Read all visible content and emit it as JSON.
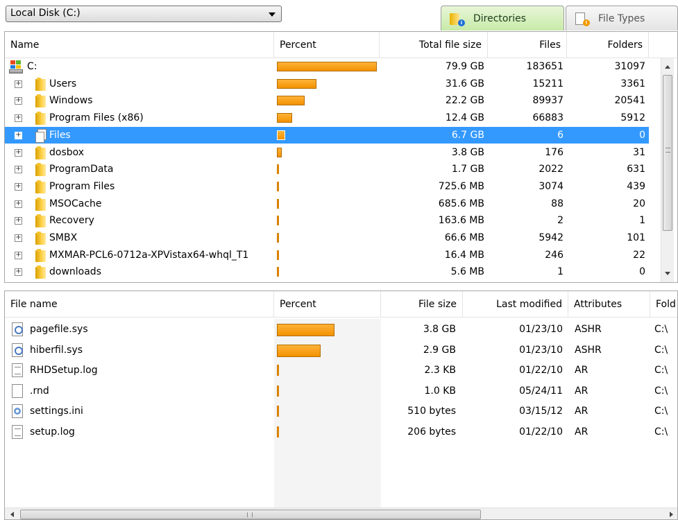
{
  "drive_select": {
    "value": "Local Disk (C:)"
  },
  "tabs": [
    {
      "label": "Directories",
      "active": true,
      "icon": "folder-info-icon"
    },
    {
      "label": "File Types",
      "active": false,
      "icon": "file-warning-icon"
    }
  ],
  "directories": {
    "columns": [
      "Name",
      "Percent",
      "Total file size",
      "Files",
      "Folders"
    ],
    "rows": [
      {
        "name": "C:",
        "percent": 100,
        "size": "79.9 GB",
        "files": "183651",
        "folders": "31097",
        "icon": "drive-icon",
        "selected": false
      },
      {
        "name": "Users",
        "percent": 39.5,
        "size": "31.6 GB",
        "files": "15211",
        "folders": "3361",
        "icon": "folder-icon",
        "selected": false
      },
      {
        "name": "Windows",
        "percent": 27.8,
        "size": "22.2 GB",
        "files": "89937",
        "folders": "20541",
        "icon": "folder-icon",
        "selected": false
      },
      {
        "name": "Program Files (x86)",
        "percent": 15.5,
        "size": "12.4 GB",
        "files": "66883",
        "folders": "5912",
        "icon": "folder-icon",
        "selected": false
      },
      {
        "name": "Files",
        "percent": 8.4,
        "size": "6.7 GB",
        "files": "6",
        "folders": "0",
        "icon": "files-icon",
        "selected": true
      },
      {
        "name": "dosbox",
        "percent": 4.8,
        "size": "3.8 GB",
        "files": "176",
        "folders": "31",
        "icon": "folder-icon",
        "selected": false
      },
      {
        "name": "ProgramData",
        "percent": 2.1,
        "size": "1.7 GB",
        "files": "2022",
        "folders": "631",
        "icon": "folder-icon",
        "selected": false
      },
      {
        "name": "Program Files",
        "percent": 0.9,
        "size": "725.6 MB",
        "files": "3074",
        "folders": "439",
        "icon": "folder-icon",
        "selected": false
      },
      {
        "name": "MSOCache",
        "percent": 0.8,
        "size": "685.6 MB",
        "files": "88",
        "folders": "20",
        "icon": "folder-icon",
        "selected": false
      },
      {
        "name": "Recovery",
        "percent": 0.2,
        "size": "163.6 MB",
        "files": "2",
        "folders": "1",
        "icon": "folder-icon",
        "selected": false
      },
      {
        "name": "SMBX",
        "percent": 0.1,
        "size": "66.6 MB",
        "files": "5942",
        "folders": "101",
        "icon": "folder-icon",
        "selected": false
      },
      {
        "name": "MXMAR-PCL6-0712a-XPVistax64-whql_T1",
        "percent": 0.02,
        "size": "16.4 MB",
        "files": "246",
        "folders": "22",
        "icon": "folder-icon",
        "selected": false
      },
      {
        "name": "downloads",
        "percent": 0.01,
        "size": "5.6 MB",
        "files": "1",
        "folders": "0",
        "icon": "folder-icon",
        "selected": false
      }
    ]
  },
  "files": {
    "columns": [
      "File name",
      "Percent",
      "File size",
      "Last modified",
      "Attributes",
      "Fold"
    ],
    "rows": [
      {
        "name": "pagefile.sys",
        "percent": 56.7,
        "size": "3.8 GB",
        "modified": "01/23/10",
        "attributes": "ASHR",
        "folder": "C:\\",
        "icon": "system-file-icon"
      },
      {
        "name": "hiberfil.sys",
        "percent": 43.3,
        "size": "2.9 GB",
        "modified": "01/23/10",
        "attributes": "ASHR",
        "folder": "C:\\",
        "icon": "system-file-icon"
      },
      {
        "name": "RHDSetup.log",
        "percent": 0.01,
        "size": "2.3 KB",
        "modified": "01/22/10",
        "attributes": "AR",
        "folder": "C:\\",
        "icon": "text-file-icon"
      },
      {
        "name": ".rnd",
        "percent": 0.01,
        "size": "1.0 KB",
        "modified": "05/24/11",
        "attributes": "AR",
        "folder": "C:\\",
        "icon": "blank-file-icon"
      },
      {
        "name": "settings.ini",
        "percent": 0.01,
        "size": "510 bytes",
        "modified": "03/15/12",
        "attributes": "AR",
        "folder": "C:\\",
        "icon": "settings-file-icon"
      },
      {
        "name": "setup.log",
        "percent": 0.01,
        "size": "206 bytes",
        "modified": "01/22/10",
        "attributes": "AR",
        "folder": "C:\\",
        "icon": "text-file-icon"
      }
    ]
  },
  "colors": {
    "bar": "#f29200",
    "selection": "#3399ff",
    "active_tab": "#c8eaa8"
  }
}
